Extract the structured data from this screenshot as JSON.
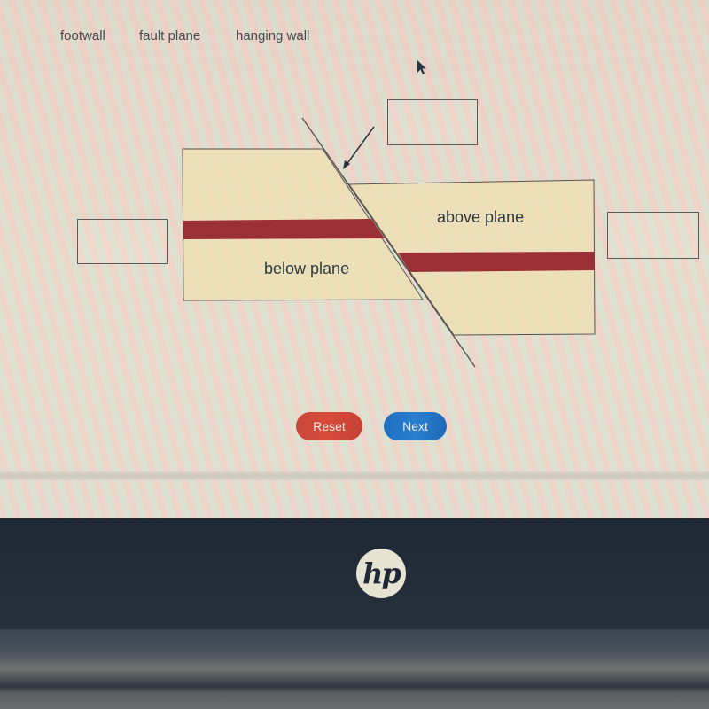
{
  "word_bank": [
    {
      "label": "footwall"
    },
    {
      "label": "fault plane"
    },
    {
      "label": "hanging wall"
    }
  ],
  "diagram": {
    "labels": {
      "above_plane": "above plane",
      "below_plane": "below plane"
    },
    "drop_targets": [
      {
        "id": "top-target",
        "value": ""
      },
      {
        "id": "left-target",
        "value": ""
      },
      {
        "id": "right-target",
        "value": ""
      }
    ],
    "colors": {
      "block_fill": "#efe2b4",
      "layer": "#9a2f35",
      "outline": "#555555"
    }
  },
  "buttons": {
    "reset": "Reset",
    "next": "Next"
  },
  "colors": {
    "reset": "#d04a3b",
    "next": "#2477c8"
  },
  "bezel": {
    "logo_text": "hp"
  }
}
